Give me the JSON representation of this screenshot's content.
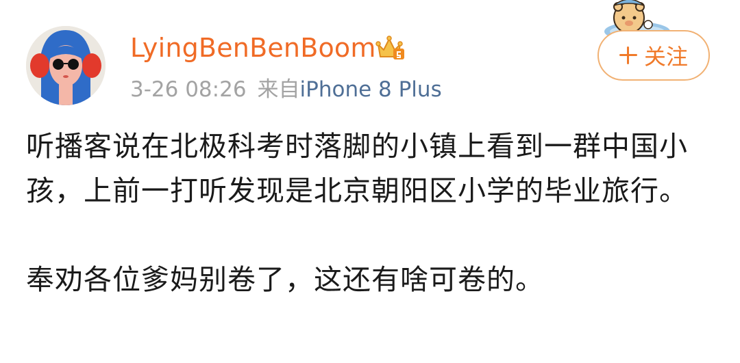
{
  "post": {
    "username": "LyingBenBenBoom",
    "time": "3-26 08:26",
    "source_prefix": "来自",
    "device": "iPhone 8 Plus",
    "follow_label": "关注",
    "paragraphs": [
      "听播客说在北极科考时落脚的小镇上看到一群中国小孩，上前一打听发现是北京朝阳区小学的毕业旅行。",
      "奉劝各位爹妈别卷了，这还有啥可卷的。"
    ]
  },
  "icons": {
    "avatar": "avatar-illustration",
    "badge": "vip-crown-badge-icon",
    "follow": "plus-icon",
    "mascot": "bear-mascot-icon"
  },
  "colors": {
    "username": "#f06b26",
    "meta": "#a3a3a3",
    "device": "#4f6f96",
    "follow_border": "#f1b173",
    "follow_text": "#f07a2a",
    "body_text": "#1a1a1a"
  }
}
